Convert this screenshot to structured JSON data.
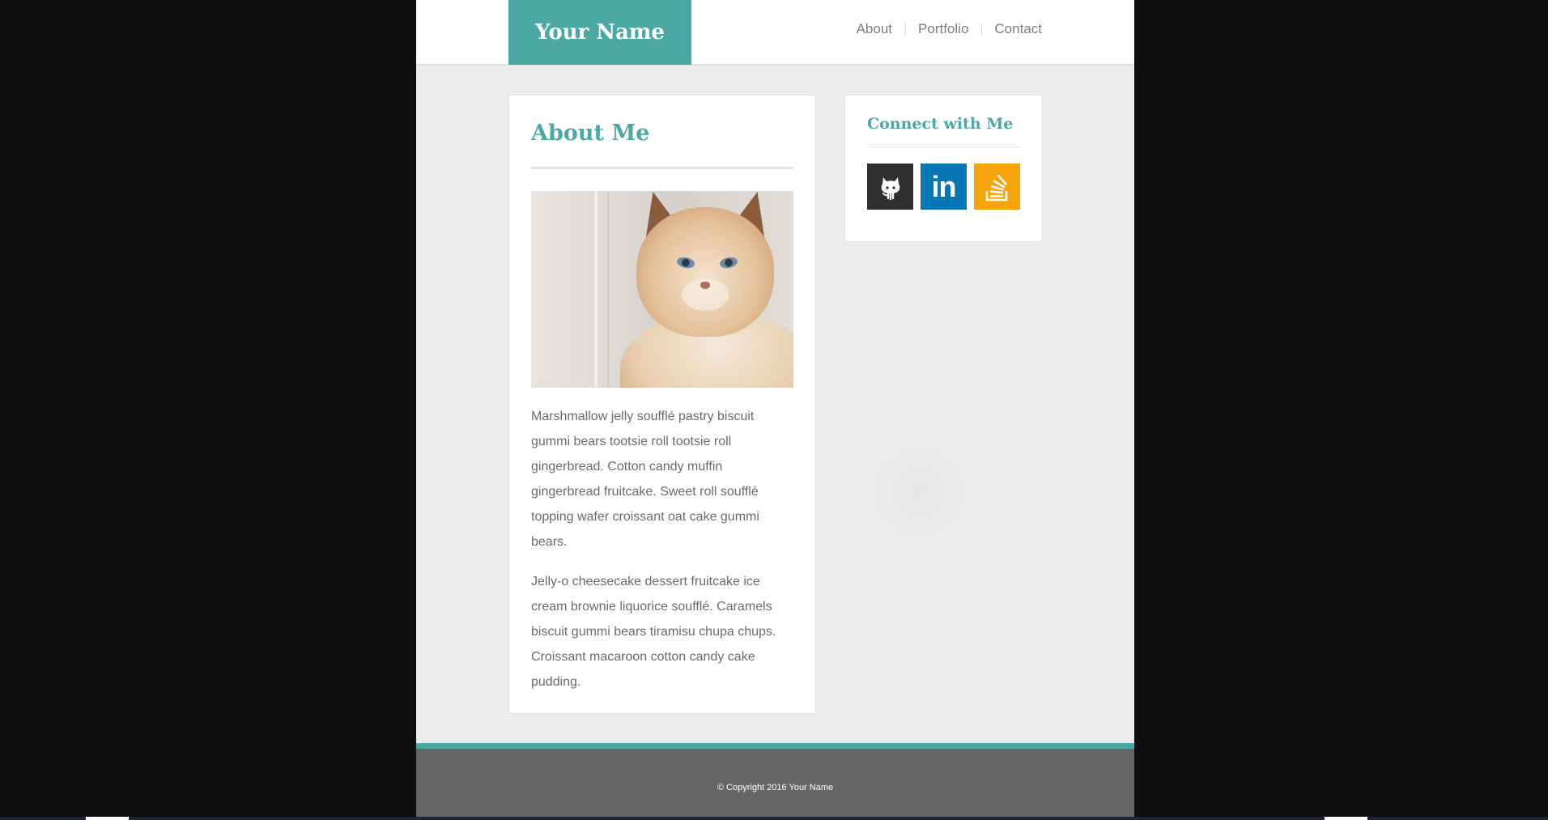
{
  "header": {
    "logo": "Your Name",
    "nav": [
      "About",
      "Portfolio",
      "Contact"
    ]
  },
  "about": {
    "title": "About Me",
    "paragraphs": [
      "Marshmallow jelly soufflé pastry biscuit gummi bears tootsie roll tootsie roll gingerbread. Cotton candy muffin gingerbread fruitcake. Sweet roll soufflé topping wafer croissant oat cake gummi bears.",
      "Jelly-o cheesecake dessert fruitcake ice cream brownie liquorice soufflé. Caramels biscuit gummi bears tiramisu chupa chups. Croissant macaroon cotton candy cake pudding."
    ]
  },
  "connect": {
    "title": "Connect with Me",
    "icons": [
      "github-icon",
      "linkedin-icon",
      "stackoverflow-icon"
    ],
    "linkedin_glyph": "in"
  },
  "footer": {
    "copyright": "© Copyright 2016 Your Name"
  },
  "colors": {
    "accent": "#4ba8a5",
    "github": "#2f2f2f",
    "linkedin": "#0877b5",
    "stackoverflow": "#f7a40b",
    "footer": "#666666"
  }
}
